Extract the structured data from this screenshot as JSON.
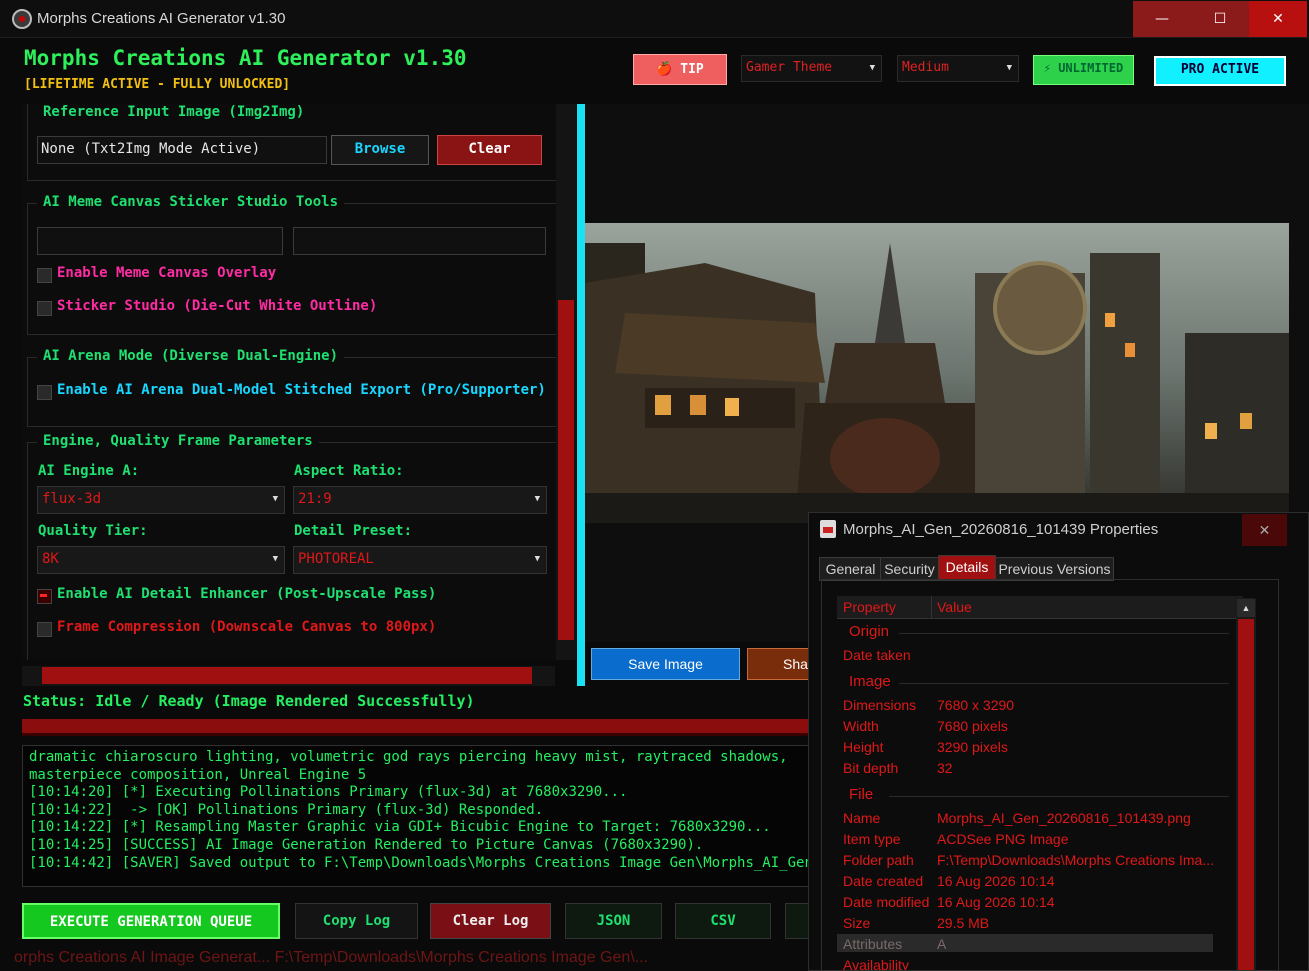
{
  "window": {
    "title": "Morphs Creations AI Generator v1.30"
  },
  "header": {
    "title": "Morphs Creations AI Generator v1.30",
    "subtitle": "[LIFETIME ACTIVE - FULLY UNLOCKED]",
    "tip_label": "🍎 TIP",
    "theme_value": "Gamer Theme",
    "quality_value": "Medium",
    "unlimited_label": "⚡ UNLIMITED",
    "pro_label": "PRO ACTIVE"
  },
  "reference": {
    "title": "Reference Input Image (Img2Img)",
    "path_value": "None (Txt2Img Mode Active)",
    "browse_label": "Browse",
    "clear_label": "Clear"
  },
  "meme": {
    "title": "AI Meme Canvas Sticker Studio Tools",
    "field1": "",
    "field2": "",
    "opt1": "Enable Meme Canvas Overlay",
    "opt2": "Sticker Studio (Die-Cut White Outline)"
  },
  "arena": {
    "title": "AI Arena Mode (Diverse Dual-Engine)",
    "opt1": "Enable AI Arena Dual-Model Stitched Export (Pro/Supporter)"
  },
  "engine": {
    "title": "Engine, Quality Frame Parameters",
    "engine_label": "AI Engine A:",
    "engine_value": "flux-3d",
    "aspect_label": "Aspect Ratio:",
    "aspect_value": "21:9",
    "quality_label": "Quality Tier:",
    "quality_value": "8K",
    "detail_label": "Detail Preset:",
    "detail_value": "PHOTOREAL",
    "enhancer_label": "Enable AI Detail Enhancer (Post-Upscale Pass)",
    "enhancer_checked": true,
    "compress_label": "Frame Compression (Downscale Canvas to 800px)",
    "compress_checked": false
  },
  "preview": {
    "save_label": "Save Image",
    "share_label": "Sha"
  },
  "status": {
    "text": "Status: Idle / Ready (Image Rendered Successfully)"
  },
  "log": {
    "lines": [
      "dramatic chiaroscuro lighting, volumetric god rays piercing heavy mist, raytraced shadows,",
      "masterpiece composition, Unreal Engine 5",
      "[10:14:20] [*] Executing Pollinations Primary (flux-3d) at 7680x3290...",
      "[10:14:22]  -> [OK] Pollinations Primary (flux-3d) Responded.",
      "[10:14:22] [*] Resampling Master Graphic via GDI+ Bicubic Engine to Target: 7680x3290...",
      "[10:14:25] [SUCCESS] AI Image Generation Rendered to Picture Canvas (7680x3290).",
      "[10:14:42] [SAVER] Saved output to F:\\Temp\\Downloads\\Morphs Creations Image Gen\\Morphs_AI_Gen_"
    ]
  },
  "actions": {
    "execute_label": "EXECUTE GENERATION QUEUE",
    "copy_label": "Copy Log",
    "clear_label": "Clear Log",
    "json_label": "JSON",
    "csv_label": "CSV"
  },
  "behind_text": "orphs Creations AI Image Generat...      F:\\Temp\\Downloads\\Morphs Creations Image Gen\\...",
  "properties": {
    "title": "Morphs_AI_Gen_20260816_101439 Properties",
    "tabs": [
      "General",
      "Security",
      "Details",
      "Previous Versions"
    ],
    "active_tab": "Details",
    "col_property": "Property",
    "col_value": "Value",
    "sections": {
      "origin": "Origin",
      "image": "Image",
      "file": "File"
    },
    "origin_rows": [
      {
        "p": "Date taken",
        "v": ""
      }
    ],
    "image_rows": [
      {
        "p": "Dimensions",
        "v": "7680 x 3290"
      },
      {
        "p": "Width",
        "v": "7680 pixels"
      },
      {
        "p": "Height",
        "v": "3290 pixels"
      },
      {
        "p": "Bit depth",
        "v": "32"
      }
    ],
    "file_rows": [
      {
        "p": "Name",
        "v": "Morphs_AI_Gen_20260816_101439.png"
      },
      {
        "p": "Item type",
        "v": "ACDSee PNG Image"
      },
      {
        "p": "Folder path",
        "v": "F:\\Temp\\Downloads\\Morphs Creations Ima..."
      },
      {
        "p": "Date created",
        "v": "16 Aug 2026 10:14"
      },
      {
        "p": "Date modified",
        "v": "16 Aug 2026 10:14"
      },
      {
        "p": "Size",
        "v": "29.5 MB"
      },
      {
        "p": "Attributes",
        "v": "A"
      },
      {
        "p": "Availability",
        "v": ""
      }
    ]
  },
  "colors": {
    "accent_green": "#24ef60",
    "accent_red": "#e01818",
    "accent_cyan": "#19e2f5",
    "subtitle_gold": "#f2c012"
  }
}
